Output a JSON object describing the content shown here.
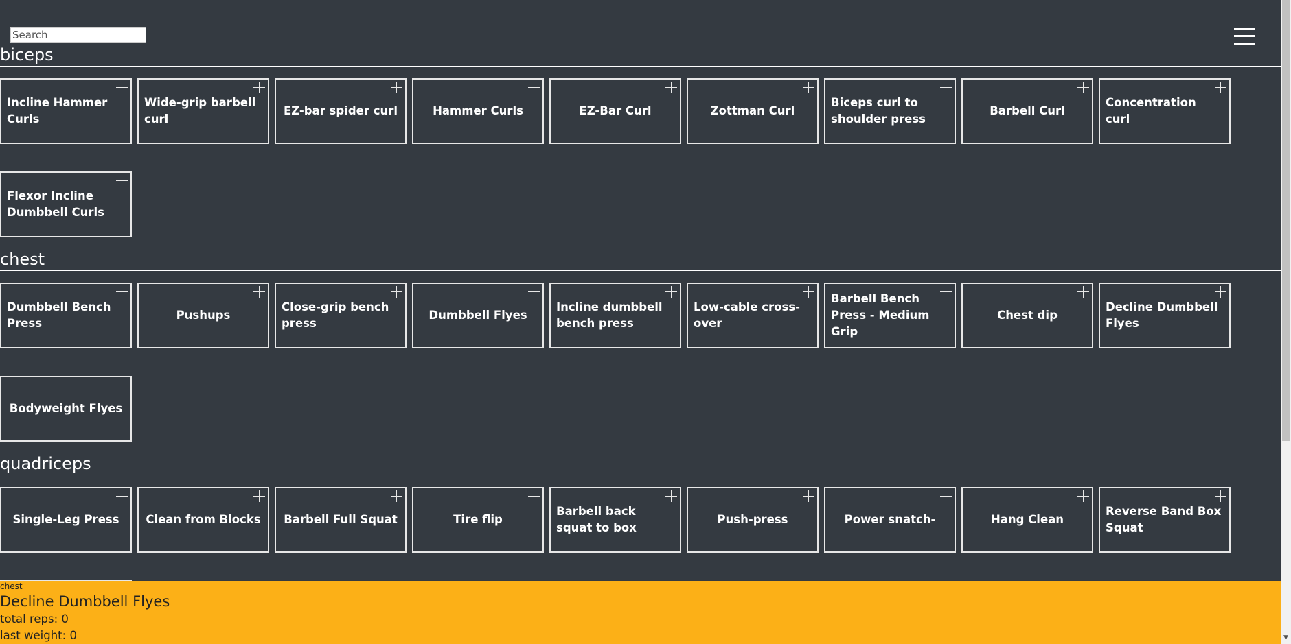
{
  "search": {
    "placeholder": "Search",
    "value": ""
  },
  "menu": {
    "icon": "hamburger-menu-icon"
  },
  "sections": [
    {
      "title": "biceps",
      "items": [
        "Incline Hammer Curls",
        "Wide-grip barbell curl",
        "EZ-bar spider curl",
        "Hammer Curls",
        "EZ-Bar Curl",
        "Zottman Curl",
        "Biceps curl to shoulder press",
        "Barbell Curl",
        "Concentration curl",
        "Flexor Incline Dumbbell Curls"
      ]
    },
    {
      "title": "chest",
      "items": [
        "Dumbbell Bench Press",
        "Pushups",
        "Close-grip bench press",
        "Dumbbell Flyes",
        "Incline dumbbell bench press",
        "Low-cable cross-over",
        "Barbell Bench Press - Medium Grip",
        "Chest dip",
        "Decline Dumbbell Flyes",
        "Bodyweight Flyes"
      ]
    },
    {
      "title": "quadriceps",
      "items": [
        "Single-Leg Press",
        "Clean from Blocks",
        "Barbell Full Squat",
        "Tire flip",
        "Barbell back squat to box",
        "Push-press",
        "Power snatch-",
        "Hang Clean",
        "Reverse Band Box Squat"
      ]
    }
  ],
  "selected": {
    "category": "chest",
    "name": "Decline Dumbbell Flyes",
    "total_reps": "total reps: 0",
    "last_weight": "last weight: 0"
  },
  "colors": {
    "background": "#343a41",
    "panel": "#fcb017",
    "border": "#e7e7e7"
  }
}
